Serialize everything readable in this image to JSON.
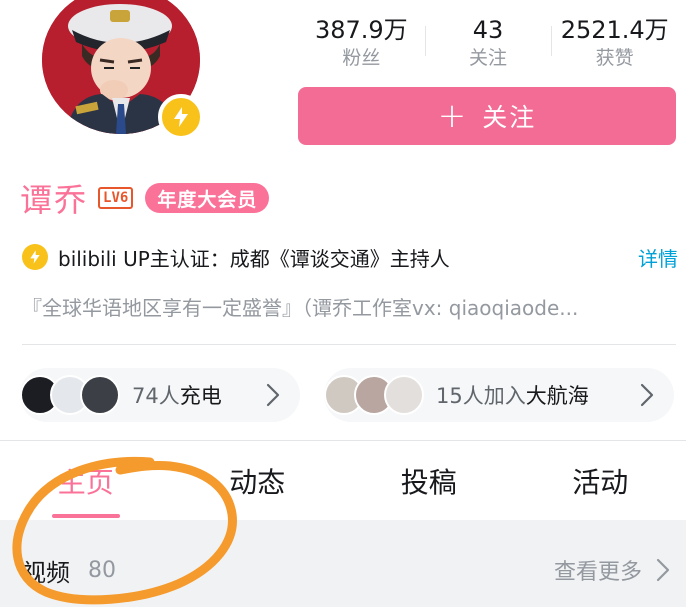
{
  "colors": {
    "pink": "#fb7299",
    "follow_bg": "#f36c96",
    "gold": "#f8c21b",
    "link_blue": "#00a1d6",
    "annotation": "#f59a2c"
  },
  "stats": [
    {
      "value": "387.9万",
      "label": "粉丝"
    },
    {
      "value": "43",
      "label": "关注"
    },
    {
      "value": "2521.4万",
      "label": "获赞"
    }
  ],
  "follow_button": {
    "icon": "plus-icon",
    "plus": "+",
    "label": "关注"
  },
  "profile": {
    "name": "谭乔",
    "level": "LV6",
    "vip": "年度大会员"
  },
  "certification": {
    "icon": "lightning-icon",
    "text": "bilibili UP主认证：成都《谭谈交通》主持人",
    "detail": "详情"
  },
  "signature": "『全球华语地区享有一定盛誉』（谭乔工作室vx: qiaoqiaode...",
  "charge": {
    "count_text": "74人",
    "action": "充电"
  },
  "crew": {
    "count_text": "15人加入",
    "action": "大航海"
  },
  "tabs": [
    {
      "label": "主页",
      "active": true
    },
    {
      "label": "动态",
      "active": false
    },
    {
      "label": "投稿",
      "active": false
    },
    {
      "label": "活动",
      "active": false
    }
  ],
  "videos": {
    "title": "视频",
    "count": "80",
    "see_more": "查看更多"
  }
}
